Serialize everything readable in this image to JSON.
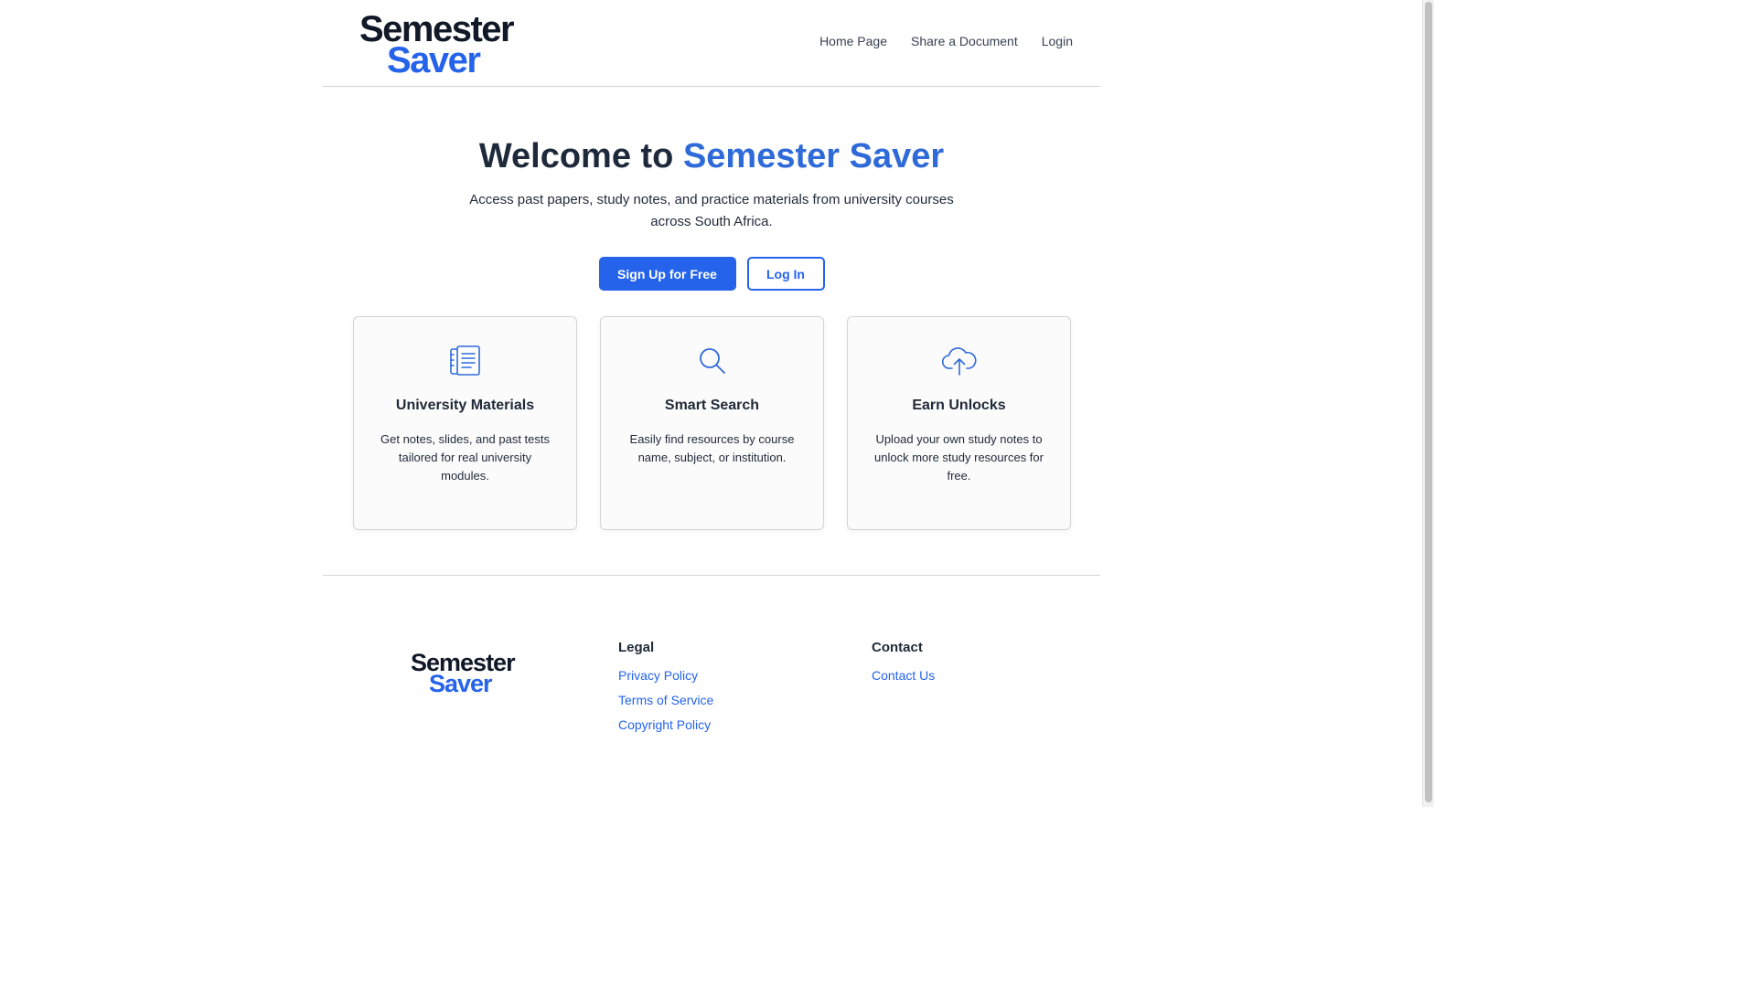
{
  "brand": {
    "line1": "Semester",
    "line2": "Saver"
  },
  "nav": {
    "items": [
      "Home Page",
      "Share a Document",
      "Login"
    ]
  },
  "hero": {
    "title_prefix": "Welcome to",
    "title_accent": "Semester Saver",
    "subtitle": "Access past papers, study notes, and practice materials from university courses across South Africa.",
    "signup_label": "Sign Up for Free",
    "login_label": "Log In"
  },
  "features": [
    {
      "icon": "document-stack-icon",
      "title": "University Materials",
      "text": "Get notes, slides, and past tests tailored for real university modules."
    },
    {
      "icon": "search-icon",
      "title": "Smart Search",
      "text": "Easily find resources by course name, subject, or institution."
    },
    {
      "icon": "cloud-upload-icon",
      "title": "Earn Unlocks",
      "text": "Upload your own study notes to unlock more study resources for free."
    }
  ],
  "footer": {
    "legal_heading": "Legal",
    "legal_links": [
      "Privacy Policy",
      "Terms of Service",
      "Copyright Policy"
    ],
    "contact_heading": "Contact",
    "contact_links": [
      "Contact Us"
    ]
  },
  "colors": {
    "accent": "#2563eb",
    "heading": "#1e293b"
  }
}
